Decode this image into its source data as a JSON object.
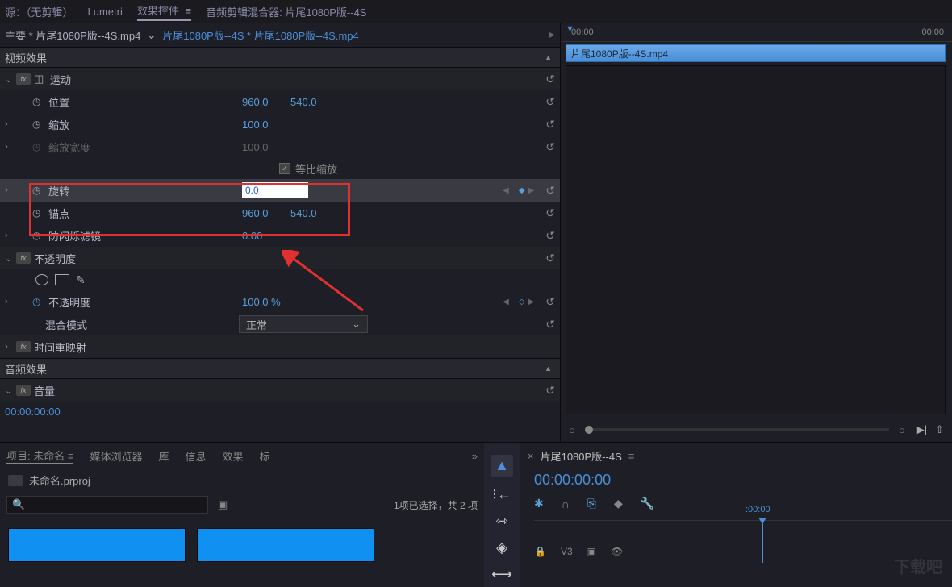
{
  "top_tabs": {
    "source": "源：（无剪辑）",
    "lumetri": "Lumetri",
    "effect_controls": "效果控件",
    "menu_glyph": "≡",
    "audio_mixer": "音频剪辑混合器: 片尾1080P版--4S"
  },
  "breadcrumb": {
    "main": "主要 * 片尾1080P版--4S.mp4",
    "dropdown": "⌄",
    "sub": "片尾1080P版--4S * 片尾1080P版--4S.mp4"
  },
  "sections": {
    "video_effects": "视频效果",
    "audio_effects": "音频效果"
  },
  "motion": {
    "label": "运动",
    "position": {
      "label": "位置",
      "x": "960.0",
      "y": "540.0"
    },
    "scale": {
      "label": "缩放",
      "value": "100.0"
    },
    "scale_width": {
      "label": "缩放宽度",
      "value": "100.0"
    },
    "uniform_scale": "等比缩放",
    "rotation": {
      "label": "旋转",
      "value": "0.0"
    },
    "anchor": {
      "label": "锚点",
      "x": "960.0",
      "y": "540.0"
    },
    "anti_flicker": {
      "label": "防闪烁滤镜",
      "value": "0.00"
    }
  },
  "opacity": {
    "label": "不透明度",
    "value_label": "不透明度",
    "value": "100.0 %",
    "blend_mode_label": "混合模式",
    "blend_mode_value": "正常"
  },
  "time_remap": {
    "label": "时间重映射"
  },
  "volume": {
    "label": "音量"
  },
  "timecode_bottom": "00:00:00:00",
  "timeline_ruler": {
    "start": ":00:00",
    "end": "00:00"
  },
  "clip_name": "片尾1080P版--4S.mp4",
  "project": {
    "tabs": {
      "project": "项目: 未命名",
      "media_browser": "媒体浏览器",
      "libraries": "库",
      "info": "信息",
      "effects": "效果",
      "markers": "标"
    },
    "name": "未命名.prproj",
    "status": "1项已选择，共 2 项"
  },
  "sequence": {
    "name": "片尾1080P版--4S",
    "timecode": "00:00:00:00",
    "playhead_time": ":00:00",
    "track_label": "V3"
  },
  "watermark": "下载吧"
}
